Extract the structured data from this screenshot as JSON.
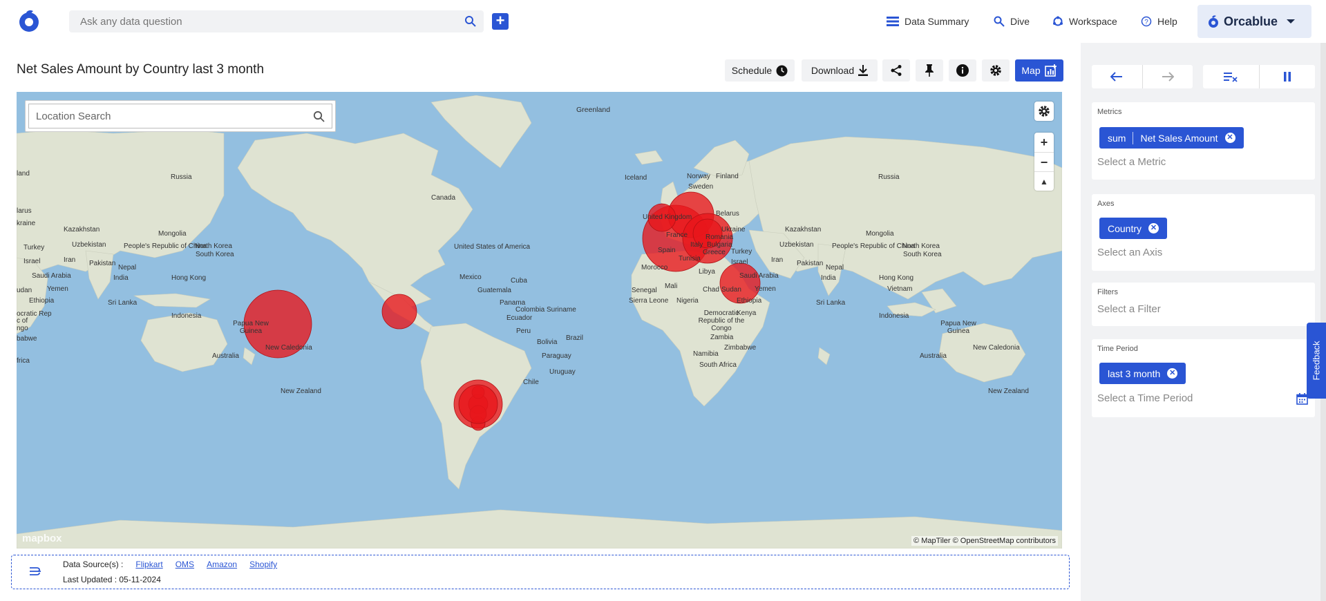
{
  "search": {
    "placeholder": "Ask any data question"
  },
  "nav": {
    "data_summary": "Data Summary",
    "dive": "Dive",
    "workspace": "Workspace",
    "help": "Help",
    "brand": "Orcablue"
  },
  "header": {
    "title": "Net Sales Amount by Country last 3 month",
    "schedule": "Schedule",
    "download": "Download",
    "map": "Map"
  },
  "map": {
    "location_search_placeholder": "Location Search",
    "attribution": "© MapTiler © OpenStreetMap contributors",
    "mapbox": "mapbox",
    "labels": {
      "greenland": "Greenland",
      "russia_l": "Russia",
      "russia_r": "Russia",
      "canada": "Canada",
      "iceland": "Iceland",
      "norway": "Norway",
      "finland": "Finland",
      "sweden": "Sweden",
      "uk": "United Kingdom",
      "belarus": "Belarus",
      "ukraine_r": "Ukraine",
      "france": "France",
      "romania": "Romania",
      "bulgaria": "Bulgaria",
      "italy": "Italy",
      "spain": "Spain",
      "greece": "Greece",
      "turkey_r": "Turkey",
      "kazakhstan_l": "Kazakhstan",
      "kazakhstan_r": "Kazakhstan",
      "mongolia_l": "Mongolia",
      "mongolia_r": "Mongolia",
      "uzbekistan_l": "Uzbekistan",
      "uzbekistan_r": "Uzbekistan",
      "prc_l": "People's Republic of China",
      "prc_r": "People's Republic of China",
      "nk_l": "North Korea",
      "sk_l": "South Korea",
      "nk_r": "North Korea",
      "sk_r": "South Korea",
      "usa": "United States of America",
      "mexico": "Mexico",
      "cuba": "Cuba",
      "guatemala": "Guatemala",
      "panama": "Panama",
      "colombia": "Colombia",
      "suriname": "Suriname",
      "ecuador": "Ecuador",
      "peru": "Peru",
      "bolivia": "Bolivia",
      "brazil": "Brazil",
      "paraguay": "Paraguay",
      "uruguay": "Uruguay",
      "chile": "Chile",
      "tunisia": "Tunisia",
      "morocco": "Morocco",
      "libya": "Libya",
      "israel": "Israel",
      "iran_r": "Iran",
      "iraq_l": "Iran",
      "saudi_r": "Saudi Arabia",
      "saudi_l": "Saudi Arabia",
      "pakistan_l": "Pakistan",
      "pakistan_r": "Pakistan",
      "nepal_l": "Nepal",
      "nepal_r": "Nepal",
      "india_l": "India",
      "india_r": "India",
      "hk_l": "Hong Kong",
      "hk_r": "Hong Kong",
      "yemen_l": "Yemen",
      "yemen_r": "Yemen",
      "mali": "Mali",
      "chad": "Chad",
      "sudan": "Sudan",
      "senegal": "Senegal",
      "sierra": "Sierra Leone",
      "nigeria": "Nigeria",
      "ethiopia_r": "Ethiopia",
      "ethiopia_l": "Ethiopia",
      "drc": "Democratic Republic of the Congo",
      "kenya": "Kenya",
      "zambia": "Zambia",
      "zimbabwe": "Zimbabwe",
      "namibia": "Namibia",
      "sa": "South Africa",
      "srilanka_l": "Sri Lanka",
      "srilanka_r": "Sri Lanka",
      "vietnam": "Vietnam",
      "indonesia_l": "Indonesia",
      "indonesia_r": "Indonesia",
      "png_l": "Papua New Guinea",
      "png_r": "Papua New Guinea",
      "australia_l": "Australia",
      "australia_r": "Australia",
      "newcal_l": "New Caledonia",
      "newcal_r": "New Caledonia",
      "nz_l": "New Zealand",
      "nz_r": "New Zealand",
      "edge_land": "land",
      "edge_larus": "larus",
      "edge_kraine": "kraine",
      "edge_turkey": "Turkey",
      "edge_israel": "Israel",
      "edge_saudi": "Saudi Arabia",
      "edge_udan": "udan",
      "edge_ethiopia": "Ethiopia",
      "edge_dem": "ocratic Rep",
      "edge_ofc": "c of",
      "edge_go": "ngo",
      "edge_zim": "babwe",
      "edge_afr": "frica"
    }
  },
  "footer": {
    "sources_label": "Data Source(s) :",
    "sources": [
      "Flipkart",
      "OMS",
      "Amazon",
      "Shopify"
    ],
    "last_updated": "Last Updated : 05-11-2024"
  },
  "panel": {
    "metrics_title": "Metrics",
    "metric_agg": "sum",
    "metric_name": "Net Sales Amount",
    "metric_placeholder": "Select a Metric",
    "axes_title": "Axes",
    "axis_name": "Country",
    "axis_placeholder": "Select an Axis",
    "filters_title": "Filters",
    "filter_placeholder": "Select a Filter",
    "time_title": "Time Period",
    "time_value": "last 3 month",
    "time_placeholder": "Select a Time Period",
    "feedback": "Feedback"
  },
  "colors": {
    "accent": "#2a55d4",
    "bubble": "#e8161b",
    "ocean": "#93bfe0",
    "land": "#dfe3d2"
  }
}
